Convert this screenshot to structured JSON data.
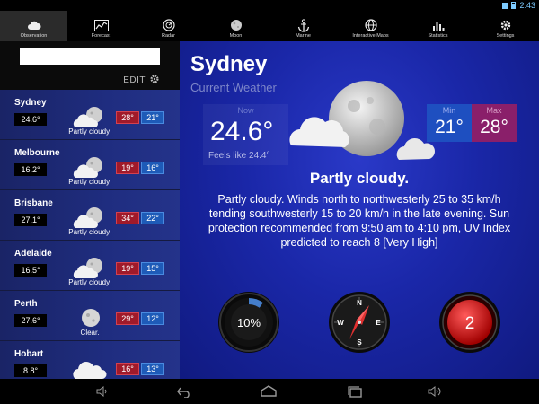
{
  "status": {
    "time": "2:43"
  },
  "tabs": [
    {
      "label": "Observation",
      "icon": "cloud-icon",
      "active": true
    },
    {
      "label": "Forecast",
      "icon": "chart-icon",
      "active": false
    },
    {
      "label": "Radar",
      "icon": "radar-icon",
      "active": false
    },
    {
      "label": "Moon",
      "icon": "moon-icon",
      "active": false
    },
    {
      "label": "Marine",
      "icon": "anchor-icon",
      "active": false
    },
    {
      "label": "Interactive Maps",
      "icon": "globe-icon",
      "active": false
    },
    {
      "label": "Statistics",
      "icon": "bars-icon",
      "active": false
    },
    {
      "label": "Settings",
      "icon": "gear-icon",
      "active": false
    }
  ],
  "sidebar": {
    "search": {
      "value": "",
      "placeholder": ""
    },
    "edit_label": "EDIT",
    "cities": [
      {
        "name": "Sydney",
        "temp": "24.6°",
        "max": "28°",
        "min": "21°",
        "condition": "Partly cloudy.",
        "icon": "partly-cloudy-icon"
      },
      {
        "name": "Melbourne",
        "temp": "16.2°",
        "max": "19°",
        "min": "16°",
        "condition": "Partly cloudy.",
        "icon": "partly-cloudy-icon"
      },
      {
        "name": "Brisbane",
        "temp": "27.1°",
        "max": "34°",
        "min": "22°",
        "condition": "Partly cloudy.",
        "icon": "partly-cloudy-icon"
      },
      {
        "name": "Adelaide",
        "temp": "16.5°",
        "max": "19°",
        "min": "15°",
        "condition": "Partly cloudy.",
        "icon": "partly-cloudy-icon"
      },
      {
        "name": "Perth",
        "temp": "27.6°",
        "max": "29°",
        "min": "12°",
        "condition": "Clear.",
        "icon": "clear-moon-icon"
      },
      {
        "name": "Hobart",
        "temp": "8.8°",
        "max": "16°",
        "min": "13°",
        "condition": "",
        "icon": "cloud-icon"
      }
    ]
  },
  "main": {
    "city": "Sydney",
    "subtitle": "Current Weather",
    "now_label": "Now",
    "now_value": "24.6°",
    "feels_like": "Feels like 24.4°",
    "min_label": "Min",
    "min_value": "21°",
    "max_label": "Max",
    "max_value": "28°",
    "condition": "Partly cloudy.",
    "forecast_text": "Partly cloudy. Winds north to northwesterly 25 to 35 km/h tending southwesterly 15 to 20 km/h in the late evening. Sun protection recommended from 9:50 am to 4:10 pm, UV Index predicted to reach 8 [Very High]",
    "humidity_gauge": {
      "label": "10%",
      "value": 10
    },
    "compass": {
      "n": "N",
      "e": "E",
      "s": "S",
      "w": "W"
    },
    "uv_gauge": {
      "label": "2"
    }
  },
  "colors": {
    "accent_blue": "#1a27a8",
    "max_red": "#a01a2a",
    "min_blue": "#1e5bb8",
    "status_blue": "#7ecbff"
  }
}
